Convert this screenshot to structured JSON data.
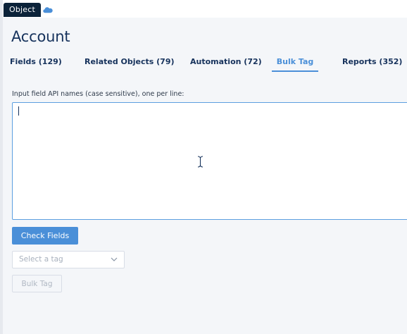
{
  "header": {
    "object_badge": "Object",
    "cloud_icon": "salesforce-cloud-icon",
    "title": "Account"
  },
  "tabs": [
    {
      "label": "Fields (129)",
      "active": false
    },
    {
      "label": "Related Objects (79)",
      "active": false
    },
    {
      "label": "Automation (72)",
      "active": false
    },
    {
      "label": "Bulk Tag",
      "active": true
    },
    {
      "label": "Reports (352)",
      "active": false
    }
  ],
  "bulk_tag": {
    "input_label": "Input field API names (case sensitive), one per line:",
    "input_value": "",
    "check_button": "Check Fields",
    "tag_select_placeholder": "Select a tag",
    "bulk_button": "Bulk Tag"
  },
  "colors": {
    "accent": "#4a8fd8",
    "badge_bg": "#0b2239",
    "text": "#16325c"
  }
}
